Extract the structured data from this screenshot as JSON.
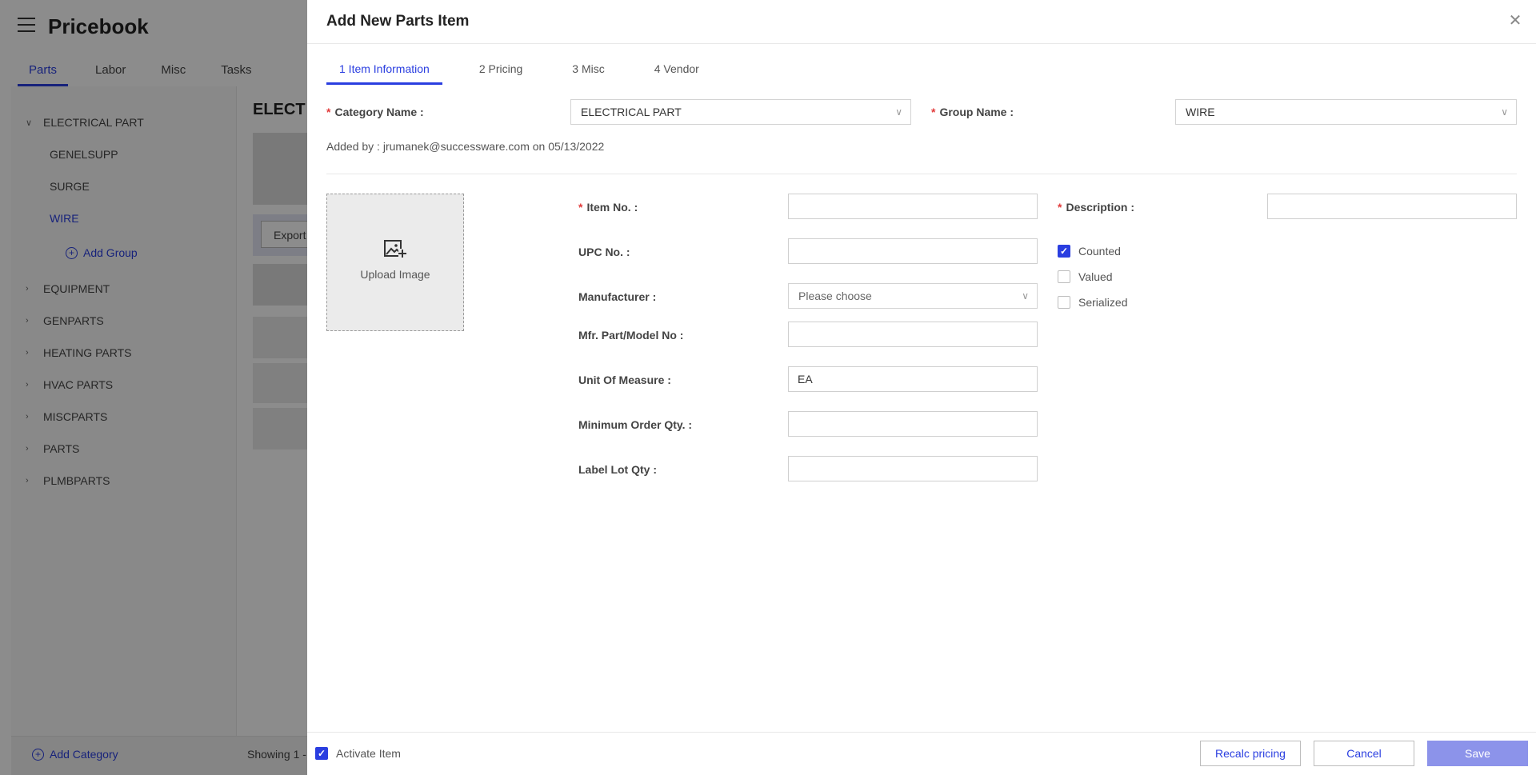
{
  "app": {
    "title": "Pricebook",
    "tabs": [
      "Parts",
      "Labor",
      "Misc",
      "Tasks"
    ],
    "content_title": "ELECT",
    "export_label": "Export",
    "add_group_label": "Add Group",
    "add_category_label": "Add Category",
    "showing_text": "Showing 1 -",
    "tree": {
      "expanded": {
        "label": "ELECTRICAL PART",
        "children": [
          "GENELSUPP",
          "SURGE",
          "WIRE"
        ],
        "active_child": "WIRE"
      },
      "collapsed": [
        "EQUIPMENT",
        "GENPARTS",
        "HEATING PARTS",
        "HVAC PARTS",
        "MISCPARTS",
        "PARTS",
        "PLMBPARTS"
      ]
    }
  },
  "drawer": {
    "title": "Add New Parts Item",
    "steps": [
      "1 Item Information",
      "2 Pricing",
      "3 Misc",
      "4 Vendor"
    ],
    "category": {
      "label": "Category Name",
      "value": "ELECTRICAL PART"
    },
    "group": {
      "label": "Group Name",
      "value": "WIRE"
    },
    "added_by": "Added by : jrumanek@successware.com on 05/13/2022",
    "upload_label": "Upload Image",
    "fields": {
      "item_no": {
        "label": "Item No.",
        "value": ""
      },
      "description": {
        "label": "Description",
        "value": ""
      },
      "upc_no": {
        "label": "UPC No.",
        "value": ""
      },
      "manufacturer": {
        "label": "Manufacturer",
        "placeholder": "Please choose"
      },
      "mfr_part": {
        "label": "Mfr. Part/Model No",
        "value": ""
      },
      "unit_of_measure": {
        "label": "Unit Of Measure",
        "value": "EA"
      },
      "min_order_qty": {
        "label": "Minimum Order Qty.",
        "value": ""
      },
      "label_lot_qty": {
        "label": "Label Lot Qty",
        "value": ""
      }
    },
    "checks": {
      "counted": {
        "label": "Counted",
        "checked": true
      },
      "valued": {
        "label": "Valued",
        "checked": false
      },
      "serialized": {
        "label": "Serialized",
        "checked": false
      }
    },
    "activate": {
      "label": "Activate Item",
      "checked": true
    },
    "buttons": {
      "recalc": "Recalc pricing",
      "cancel": "Cancel",
      "save": "Save"
    },
    "colors": {
      "accent": "#2a3ee0",
      "save_disabled": "#8c93ea",
      "required": "#e23b3b"
    }
  }
}
